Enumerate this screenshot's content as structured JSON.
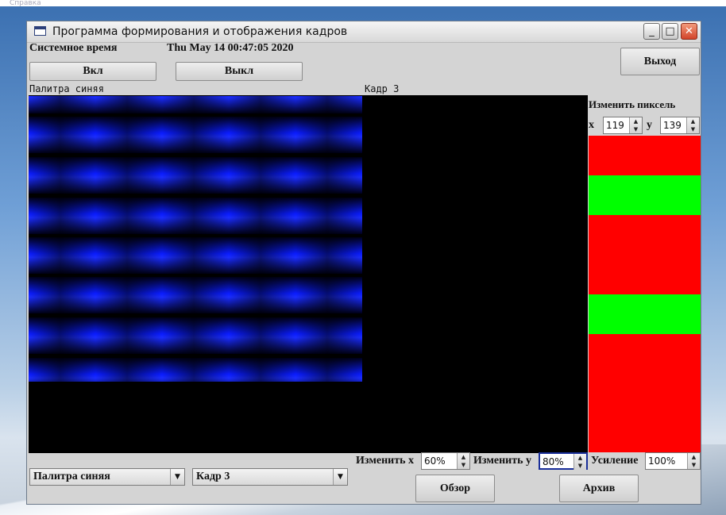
{
  "desktop": {
    "top_text": "Справка"
  },
  "window": {
    "title": "Программа формирования и отображения кадров",
    "controls": {
      "minimize": "_",
      "maximize": "□",
      "close": "✕"
    }
  },
  "header": {
    "system_time_label": "Системное время",
    "system_time_value": "Thu May 14 00:47:05 2020",
    "on_button": "Вкл",
    "off_button": "Выкл",
    "exit_button": "Выход"
  },
  "panels": {
    "palette_label": "Палитра синяя",
    "frame_label": "Кадр 3"
  },
  "pixel_editor": {
    "title": "Изменить пиксель",
    "x_label": "x",
    "x_value": "119",
    "y_label": "y",
    "y_value": "139",
    "blocks": [
      {
        "color": "#ff0000"
      },
      {
        "color": "#00ff00"
      },
      {
        "color": "#ff0000"
      },
      {
        "color": "#00ff00"
      },
      {
        "color": "#ff0000"
      }
    ]
  },
  "bottom": {
    "palette_select": "Палитра синяя",
    "frame_select": "Кадр 3",
    "change_x_label": "Изменить x",
    "change_x_value": "60%",
    "change_y_label": "Изменить y",
    "change_y_value": "80%",
    "gain_label": "Усиление",
    "gain_value": "100%",
    "browse_button": "Обзор",
    "archive_button": "Архив"
  },
  "colors": {
    "palette_blue": "#0a1cff",
    "pixel_red": "#ff0000",
    "pixel_green": "#00ff00",
    "window_bg": "#d4d4d4"
  }
}
